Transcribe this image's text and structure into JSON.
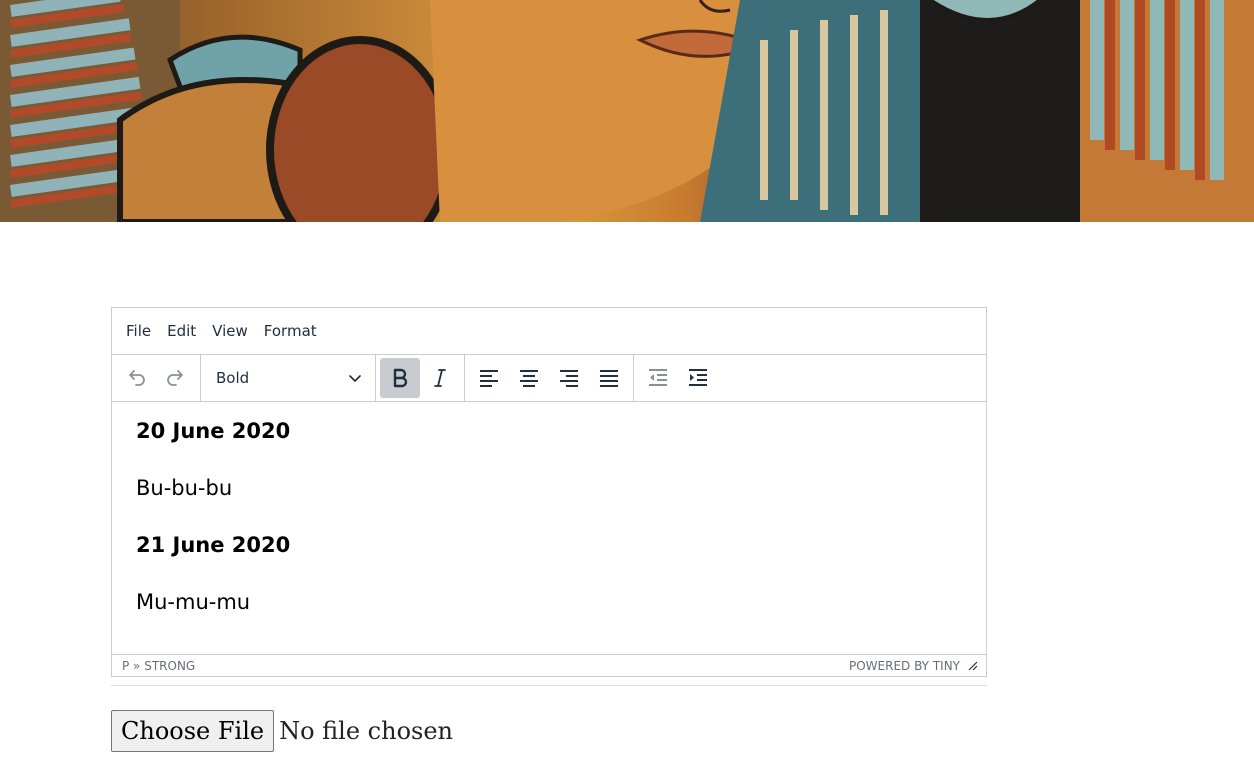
{
  "editor": {
    "menubar": [
      "File",
      "Edit",
      "View",
      "Format"
    ],
    "toolbar": {
      "format_select_value": "Bold",
      "bold_active": true
    },
    "content": [
      {
        "date": "20 June 2020",
        "text": "Bu-bu-bu"
      },
      {
        "date": "21 June 2020",
        "text": "Mu-mu-mu"
      }
    ],
    "statusbar": {
      "path": "P » STRONG",
      "branding": "POWERED BY TINY"
    }
  },
  "file_input": {
    "button_label": "Choose File",
    "status": "No file chosen"
  },
  "colors": {
    "toolbar_icon": "#222f3e",
    "disabled_icon": "#8a9099",
    "active_button_bg": "#c8cbcf",
    "border": "#cccccc"
  }
}
